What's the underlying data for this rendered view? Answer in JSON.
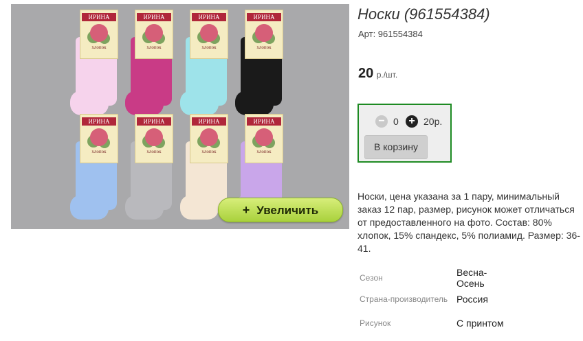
{
  "product": {
    "image": {
      "alt": "Носки",
      "tag_brand": "ИРИНА",
      "tag_subtext": "хлопок",
      "zoom_button_label": "Увеличить",
      "zoom_icon": "+",
      "sock_colors": [
        "#f6d3ec",
        "#c93b86",
        "#9ee3ea",
        "#1a1a1a",
        "#9fc1ef",
        "#b9b9bd",
        "#f4e6d4",
        "#c9a6ea"
      ]
    },
    "title": "Носки (961554384)",
    "sku": "Арт: 961554384",
    "price": {
      "value": "20",
      "unit": "р./шт."
    },
    "cart": {
      "minus_icon": "−",
      "quantity": "0",
      "plus_icon": "+",
      "total": "20р.",
      "add_button_label": "В корзину",
      "border_color": "#1d8a22"
    },
    "description": "Носки, цена указана за 1 пару, минимальный заказ 12 пар, размер, рисунок может отличаться от предоставленного на фото. Состав: 80% хлопок, 15% спандекс, 5% полиамид. Размер: 36-41.",
    "specs": [
      {
        "label": "Сезон",
        "value": "Весна-Осень"
      },
      {
        "label": "Страна-производитель",
        "value": "Россия"
      },
      {
        "label": "Рисунок",
        "value": "С принтом"
      }
    ]
  }
}
